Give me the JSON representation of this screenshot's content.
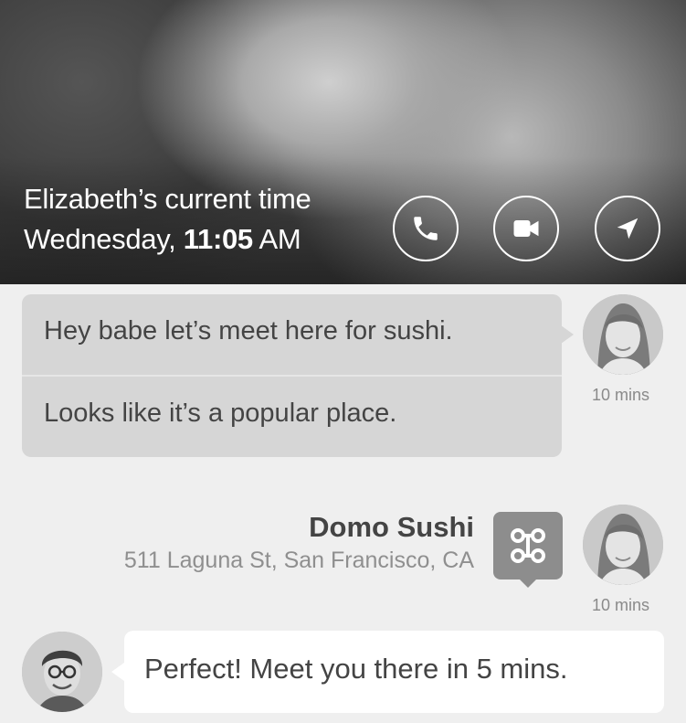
{
  "header": {
    "title": "Elizabeth’s current time",
    "day": "Wednesday,",
    "time": "11:05",
    "ampm": "AM",
    "actions": [
      {
        "name": "call",
        "icon": "phone-icon"
      },
      {
        "name": "video",
        "icon": "video-camera-icon"
      },
      {
        "name": "navigate",
        "icon": "location-arrow-icon"
      }
    ]
  },
  "messages": {
    "incoming": [
      "Hey babe let’s meet here for sushi.",
      "Looks like it’s a popular place."
    ],
    "incoming_time": "10 mins",
    "location": {
      "name": "Domo Sushi",
      "address": "511 Laguna St, San Francisco, CA",
      "time": "10 mins",
      "icon": "restaurant-map-icon"
    },
    "outgoing": "Perfect! Meet you there in 5 mins."
  },
  "colors": {
    "background": "#efefef",
    "incoming_bubble": "#d6d6d6",
    "outgoing_bubble": "#ffffff",
    "text": "#444444",
    "muted": "#8a8a8a"
  }
}
